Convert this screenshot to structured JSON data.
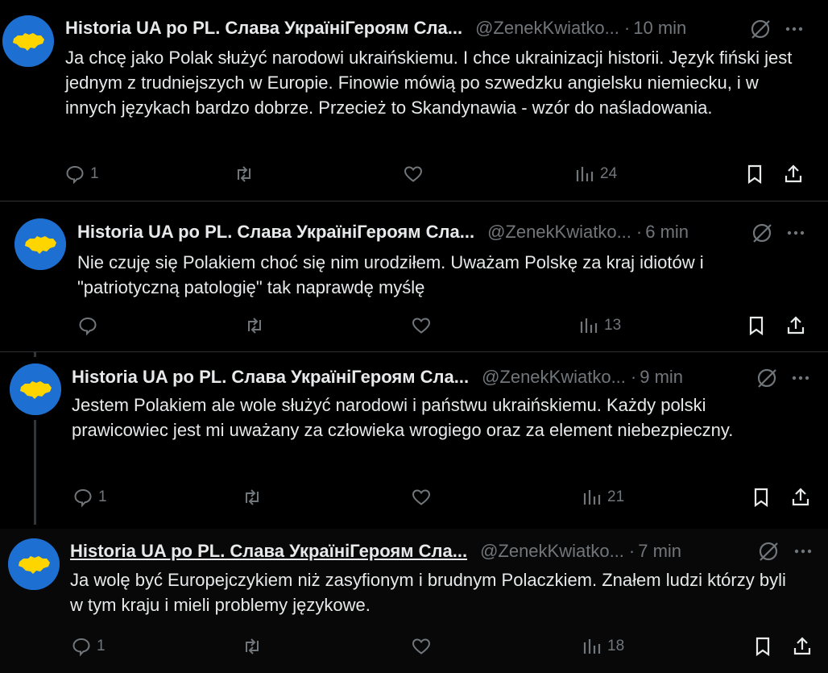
{
  "tweets": [
    {
      "name": "Historia UA po PL. Слава УкраїніГероям Сла...",
      "handle": "@ZenekKwiatko...",
      "time": "10 min",
      "text": "Ja chcę jako Polak służyć narodowi ukraińskiemu. I chce ukrainizacji historii. Język fiński jest jednym z trudniejszych w Europie. Finowie mówią po szwedzku angielsku niemiecku, i w innych językach bardzo dobrze. Przecież to Skandynawia - wzór do naśladowania.",
      "replies": "1",
      "reposts": "",
      "likes": "",
      "views": "24"
    },
    {
      "name": "Historia UA po PL. Слава УкраїніГероям Сла...",
      "handle": "@ZenekKwiatko...",
      "time": "6 min",
      "text": "Nie czuję się Polakiem choć się nim urodziłem. Uważam Polskę za kraj idiotów i \"patriotyczną patologię\" tak naprawdę myślę",
      "replies": "",
      "reposts": "",
      "likes": "",
      "views": "13"
    },
    {
      "name": "Historia UA po PL. Слава УкраїніГероям Сла...",
      "handle": "@ZenekKwiatko...",
      "time": "9 min",
      "text": "Jestem Polakiem ale wole służyć narodowi i państwu ukraińskiemu. Każdy polski prawicowiec jest mi uważany za człowieka wrogiego oraz za element niebezpieczny.",
      "replies": "1",
      "reposts": "",
      "likes": "",
      "views": "21"
    },
    {
      "name": "Historia UA po PL. Слава УкраїніГероям Сла...",
      "handle": "@ZenekKwiatko...",
      "time": "7 min",
      "text": "Ja wolę być Europejczykiem niż zasyfionym i brudnym Polaczkiem. Znałem ludzi którzy byli w tym kraju i mieli problemy językowe.",
      "replies": "1",
      "reposts": "",
      "likes": "",
      "views": "18"
    }
  ],
  "colors": {
    "background": "#000000",
    "text": "#e7e9ea",
    "muted": "#71767b",
    "avatar": "#1d6fd1",
    "flag": "#ffd500"
  },
  "icons": [
    "reply-icon",
    "repost-icon",
    "like-icon",
    "views-icon",
    "bookmark-icon",
    "share-icon",
    "grok-icon",
    "more-icon"
  ]
}
